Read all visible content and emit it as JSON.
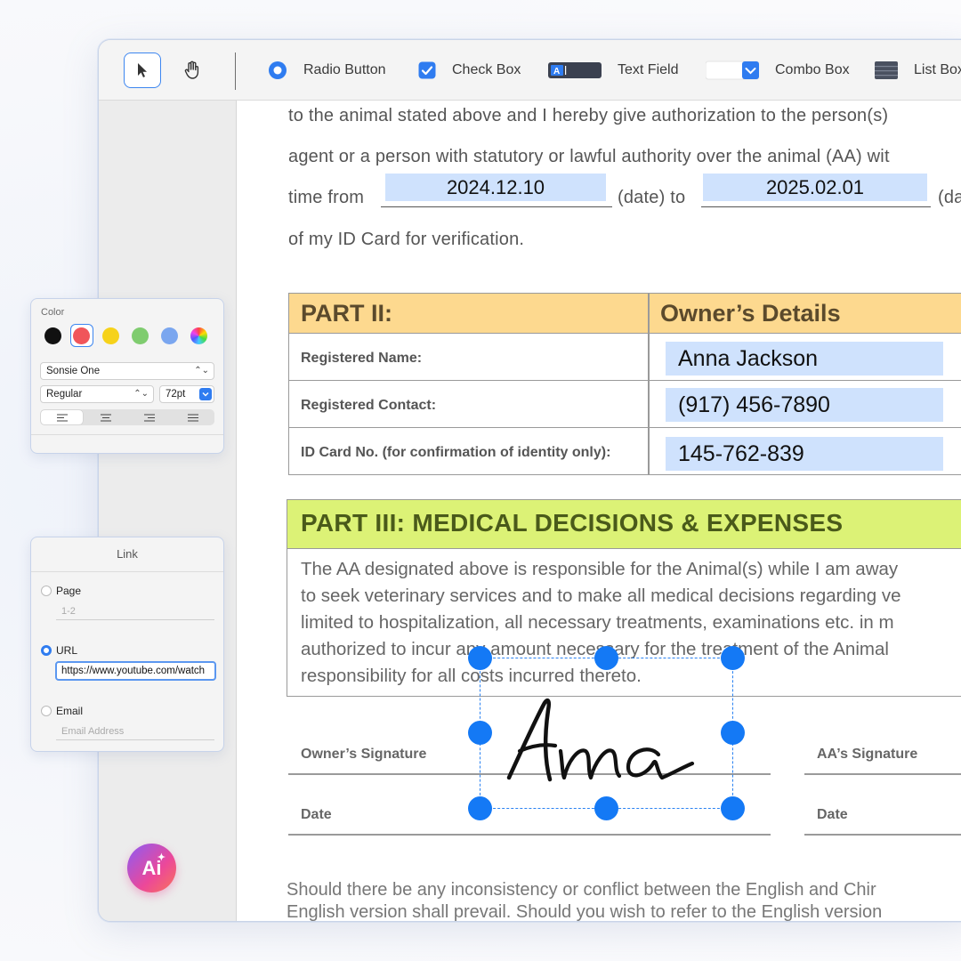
{
  "toolbar": {
    "items": [
      {
        "label": "Radio Button",
        "icon": "radio-button-icon"
      },
      {
        "label": "Check Box",
        "icon": "checkbox-icon"
      },
      {
        "label": "Text Field",
        "icon": "text-field-icon"
      },
      {
        "label": "Combo Box",
        "icon": "combo-box-icon"
      },
      {
        "label": "List Box",
        "icon": "list-box-icon"
      }
    ],
    "tools": [
      "select-arrow-icon",
      "hand-tool-icon"
    ]
  },
  "document": {
    "para_lines": [
      "to the animal stated above and I hereby give authorization to the person(s)",
      "agent or a person with statutory or lawful authority over the animal (AA) wit",
      "time from",
      "(date) to",
      "(da",
      "of my ID Card for verification."
    ],
    "date_from": "2024.12.10",
    "date_to": "2025.02.01",
    "part2": {
      "title": "PART II:",
      "right_title": "Owner’s Details",
      "rows": [
        {
          "label": "Registered Name:",
          "value": "Anna Jackson"
        },
        {
          "label": "Registered Contact:",
          "value": "(917) 456-7890"
        },
        {
          "label": "ID Card No. (for confirmation of identity only):",
          "value": "145-762-839"
        }
      ]
    },
    "part3": {
      "title": "PART III: MEDICAL DECISIONS & EXPENSES",
      "lines": [
        "The AA designated above is responsible for the Animal(s) while I am away",
        "to seek veterinary services and to make all medical decisions regarding ve",
        "limited to hospitalization, all necessary treatments, examinations etc. in m",
        "authorized to incur any amount necessary for the treatment of the Animal",
        "responsibility for all costs incurred thereto."
      ]
    },
    "signatures": {
      "owner_label": "Owner’s Signature",
      "aa_label": "AA’s Signature",
      "date_left": "Date",
      "date_right": "Date",
      "signature_text": "Anna"
    },
    "footer_lines": [
      "Should there be any inconsistency or conflict between the English and Chir",
      "English version shall prevail. Should you wish to refer to the English version"
    ]
  },
  "color_panel": {
    "title": "Color",
    "swatches": [
      "#111111",
      "#f0555a",
      "#f6d21a",
      "#7fcc6f",
      "#7aa6ef"
    ],
    "selected_swatch": "#f0555a",
    "font": "Sonsie One",
    "style": "Regular",
    "size": "72pt"
  },
  "link_panel": {
    "title": "Link",
    "page_label": "Page",
    "page_placeholder": "1-2",
    "url_label": "URL",
    "url_value": "https://www.youtube.com/watch",
    "email_label": "Email",
    "email_placeholder": "Email Address",
    "selected": "URL"
  },
  "ai_button": {
    "label": "Ai"
  }
}
